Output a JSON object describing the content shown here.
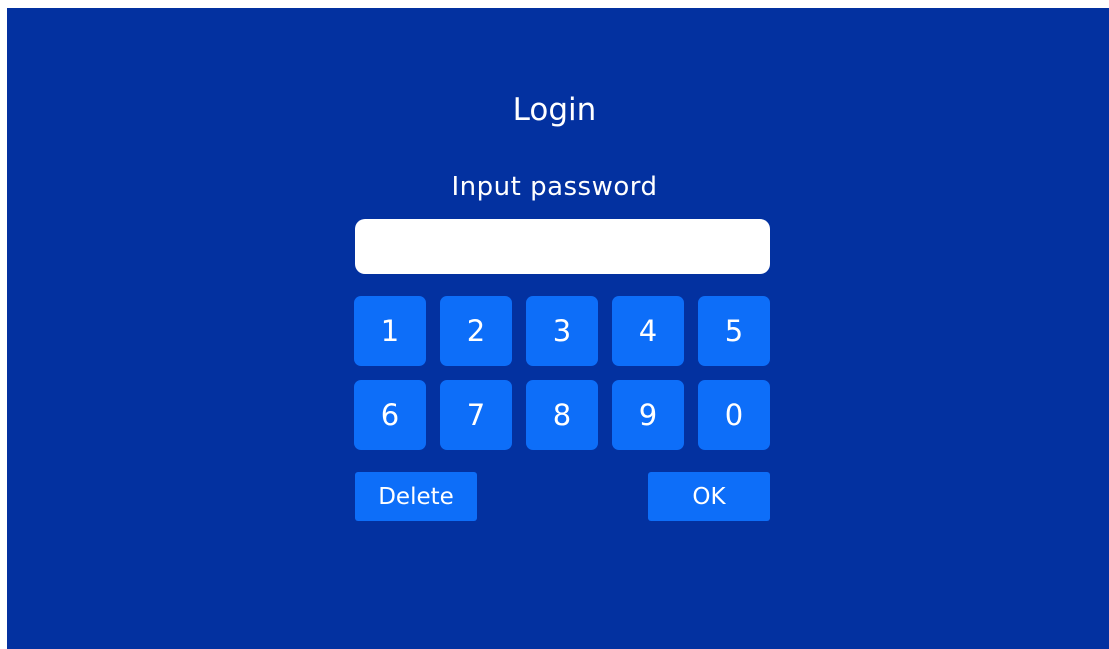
{
  "login": {
    "title": "Login",
    "prompt": "Input password",
    "password_value": "",
    "keys": [
      "1",
      "2",
      "3",
      "4",
      "5",
      "6",
      "7",
      "8",
      "9",
      "0"
    ],
    "delete_label": "Delete",
    "ok_label": "OK"
  },
  "colors": {
    "background": "#0331a0",
    "button": "#0d6ef9",
    "field": "#ffffff",
    "text": "#ffffff"
  }
}
